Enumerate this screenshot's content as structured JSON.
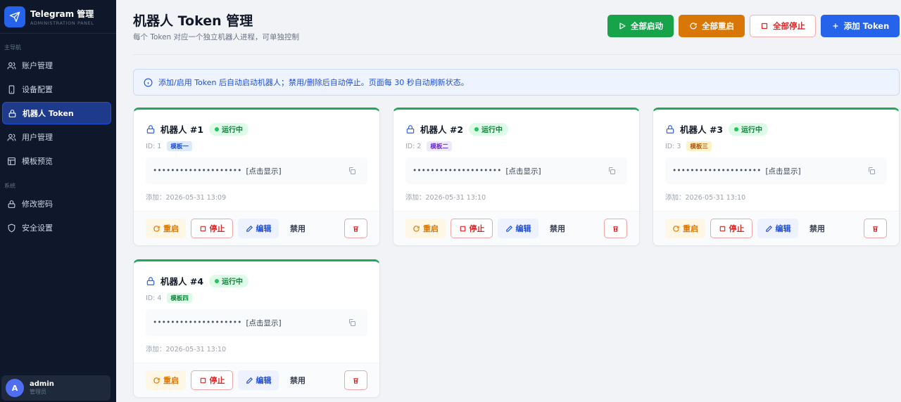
{
  "sidebar": {
    "brand_title": "Telegram 管理",
    "brand_subtitle": "ADMINISTRATION PANEL",
    "section_main": "主导航",
    "section_system": "系统",
    "items": [
      {
        "label": "账户管理"
      },
      {
        "label": "设备配置"
      },
      {
        "label": "机器人 Token"
      },
      {
        "label": "用户管理"
      },
      {
        "label": "模板预览"
      },
      {
        "label": "修改密码"
      },
      {
        "label": "安全设置"
      }
    ],
    "user": {
      "initial": "A",
      "name": "admin",
      "role": "管理员"
    }
  },
  "header": {
    "title": "机器人 Token 管理",
    "subtitle": "每个 Token 对应一个独立机器人进程，可单独控制",
    "actions": {
      "start_all": "全部启动",
      "restart_all": "全部重启",
      "stop_all": "全部停止",
      "add_token": "添加 Token"
    }
  },
  "notice": "添加/启用 Token 后自动启动机器人；禁用/删除后自动停止。页面每 30 秒自动刷新状态。",
  "cards": [
    {
      "name": "机器人 #1",
      "status": "运行中",
      "id": "ID: 1",
      "template": "模板一",
      "token": "••••••••••••••••••••",
      "reveal": "[点击显示]",
      "added": "添加：2026-05-31 13:09",
      "restart": "重启",
      "stop": "停止",
      "edit": "编辑",
      "disable": "禁用"
    },
    {
      "name": "机器人 #2",
      "status": "运行中",
      "id": "ID: 2",
      "template": "模板二",
      "token": "••••••••••••••••••••",
      "reveal": "[点击显示]",
      "added": "添加：2026-05-31 13:10",
      "restart": "重启",
      "stop": "停止",
      "edit": "编辑",
      "disable": "禁用"
    },
    {
      "name": "机器人 #3",
      "status": "运行中",
      "id": "ID: 3",
      "template": "模板三",
      "token": "••••••••••••••••••••",
      "reveal": "[点击显示]",
      "added": "添加：2026-05-31 13:10",
      "restart": "重启",
      "stop": "停止",
      "edit": "编辑",
      "disable": "禁用"
    },
    {
      "name": "机器人 #4",
      "status": "运行中",
      "id": "ID: 4",
      "template": "模板四",
      "token": "••••••••••••••••••••",
      "reveal": "[点击显示]",
      "added": "添加：2026-05-31 13:10",
      "restart": "重启",
      "stop": "停止",
      "edit": "编辑",
      "disable": "禁用"
    }
  ],
  "colors": {
    "sidebar_bg": "#0f172a",
    "accent": "#2563eb",
    "success": "#16a34a",
    "warning": "#d97706",
    "danger": "#dc2626"
  },
  "icons": {
    "brand": "paper-plane-icon",
    "lock": "lock-icon",
    "copy": "copy-icon"
  }
}
